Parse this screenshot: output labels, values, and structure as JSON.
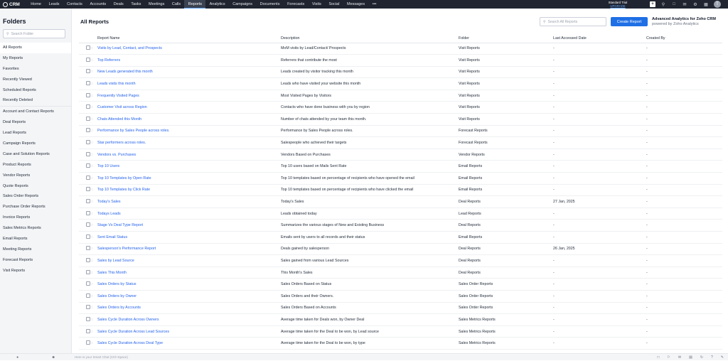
{
  "app": {
    "name": "CRM"
  },
  "nav": {
    "tabs": [
      "Home",
      "Leads",
      "Contacts",
      "Accounts",
      "Deals",
      "Tasks",
      "Meetings",
      "Calls",
      "Reports",
      "Analytics",
      "Campaigns",
      "Documents",
      "Forecasts",
      "Visits",
      "Social",
      "Messages",
      "•••"
    ],
    "active": "Reports"
  },
  "trial": {
    "label": "Standard Trial",
    "upgrade": "UPGRADE"
  },
  "topicons": [
    "plus-icon",
    "search-icon",
    "calendar-icon",
    "messages-icon",
    "settings-icon",
    "apps-icon"
  ],
  "user": {
    "initial": "T"
  },
  "sidebar": {
    "title": "Folders",
    "search_placeholder": "Search Folder",
    "group1": [
      "All Reports",
      "My Reports",
      "Favorites",
      "Recently Viewed",
      "Scheduled Reports",
      "Recently Deleted"
    ],
    "group2": [
      "Account and Contact Reports",
      "Deal Reports",
      "Lead Reports",
      "Campaign Reports",
      "Case and Solution Reports",
      "Product Reports",
      "Vendor Reports",
      "Quote Reports",
      "Sales Order Reports",
      "Purchase Order Reports",
      "Invoice Reports",
      "Sales Metrics Reports",
      "Email Reports",
      "Meeting Reports",
      "Forecast Reports",
      "Visit Reports"
    ],
    "active": "All Reports"
  },
  "main": {
    "title": "All Reports",
    "search_placeholder": "Search All Reports",
    "create_label": "Create Report",
    "analytics_title": "Advanced Analytics for Zoho CRM",
    "analytics_sub": "powered by Zoho Analytics"
  },
  "table": {
    "columns": [
      "Report Name",
      "Description",
      "Folder",
      "Last Accessed Date",
      "Created By"
    ],
    "rows": [
      [
        "Visits by Lead, Contact, and Prospects",
        "MoM visits by Lead/Contact/ Prospects",
        "Visit Reports",
        "-",
        "-"
      ],
      [
        "Top Referrers",
        "Referrers that contribute the most",
        "Visit Reports",
        "-",
        "-"
      ],
      [
        "New Leads generated this month",
        "Leads created by visitor tracking this month",
        "Visit Reports",
        "-",
        "-"
      ],
      [
        "Leads visits this month",
        "Leads who have visited your website this month",
        "Visit Reports",
        "-",
        "-"
      ],
      [
        "Frequently Visited Pages",
        "Most Visited Pages by Visitors",
        "Visit Reports",
        "-",
        "-"
      ],
      [
        "Customer Visit across Region",
        "Contacts who have done business with you by region",
        "Visit Reports",
        "-",
        "-"
      ],
      [
        "Chats Attended this Month",
        "Number of chats attended by your team this month.",
        "Visit Reports",
        "-",
        "-"
      ],
      [
        "Performance by Sales People across roles.",
        "Performance by Sales People across roles.",
        "Forecast Reports",
        "-",
        "-"
      ],
      [
        "Star performers across roles.",
        "Salespeople who achieved their targets",
        "Forecast Reports",
        "-",
        "-"
      ],
      [
        "Vendors vs. Purchases",
        "Vendors Based on Purchases",
        "Vendor Reports",
        "-",
        "-"
      ],
      [
        "Top 10 Users",
        "Top 10 users based on Mails Sent Rate",
        "Email Reports",
        "-",
        "-"
      ],
      [
        "Top 10 Templates by Open Rate",
        "Top 10 templates based on percentage of recipients who have opened the email",
        "Email Reports",
        "-",
        "-"
      ],
      [
        "Top 10 Templates by Click Rate",
        "Top 10 templates based on percentage of recipients who have clicked the email",
        "Email Reports",
        "-",
        "-"
      ],
      [
        "Today's Sales",
        "Today's Sales",
        "Deal Reports",
        "27 Jan, 2025",
        "-"
      ],
      [
        "Todays Leads",
        "Leads obtained today",
        "Lead Reports",
        "-",
        "-"
      ],
      [
        "Stage Vs Deal Type Report",
        "Summarizes the various stages of New and Existing Business",
        "Deal Reports",
        "-",
        "-"
      ],
      [
        "Sent Email Status",
        "Emails sent by users to all records and their status",
        "Email Reports",
        "-",
        "-"
      ],
      [
        "Salesperson's Performance Report",
        "Deals gained by salesperson",
        "Deal Reports",
        "26 Jan, 2025",
        "-"
      ],
      [
        "Sales by Lead Source",
        "Sales gained from various Lead Sources",
        "Deal Reports",
        "-",
        "-"
      ],
      [
        "Sales This Month",
        "This Month's Sales",
        "Deal Reports",
        "-",
        "-"
      ],
      [
        "Sales Orders by Status",
        "Sales Orders Based on Status",
        "Sales Order Reports",
        "-",
        "-"
      ],
      [
        "Sales Orders by Owner",
        "Sales Orders and their Owners.",
        "Sales Order Reports",
        "-",
        "-"
      ],
      [
        "Sales Orders by Accounts",
        "Sales Orders Based on Accounts",
        "Sales Order Reports",
        "-",
        "-"
      ],
      [
        "Sales Cycle Duration Across Owners",
        "Average time taken for Deals won, by Owner Deal",
        "Sales Metrics Reports",
        "-",
        "-"
      ],
      [
        "Sales Cycle Duration Across Lead Sources",
        "Average time taken for the Deal to be won, by Lead source",
        "Sales Metrics Reports",
        "-",
        "-"
      ],
      [
        "Sales Cycle Duration Across Deal Type",
        "Average time taken for the Deal to be won, by type",
        "Sales Metrics Reports",
        "-",
        "-"
      ]
    ]
  },
  "bottom": {
    "chat_placeholder": "Here is your Smart Chat (Ctrl+Space)"
  }
}
